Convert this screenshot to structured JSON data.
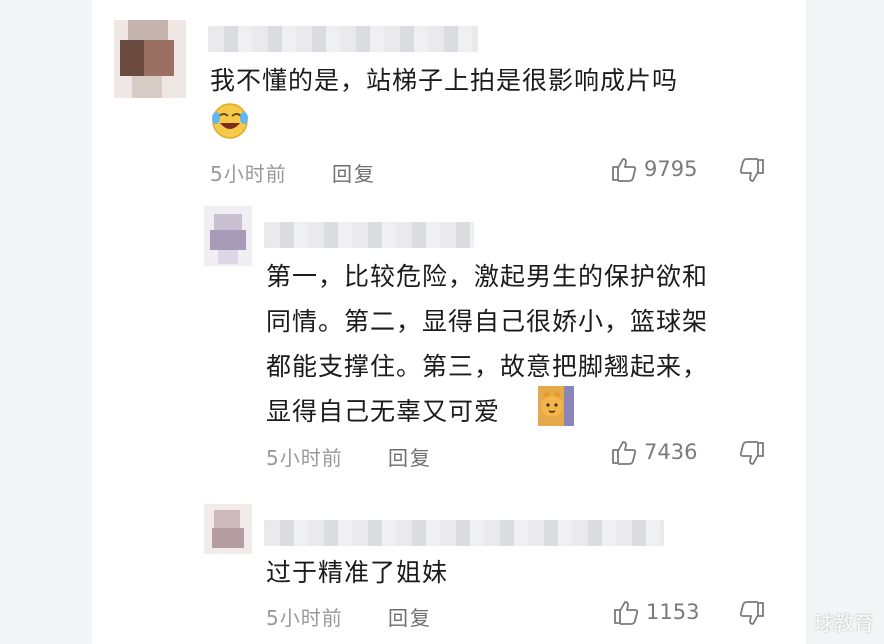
{
  "comments": [
    {
      "text": "我不懂的是，站梯子上拍是很影响成片吗",
      "emoji": "crying-laughing-emoji",
      "time": "5小时前",
      "reply": "回复",
      "likes": "9795"
    },
    {
      "text": "第一，比较危险，激起男生的保护欲和\n同情。第二，显得自己很娇小，篮球架\n都能支撑住。第三，故意把脚翘起来，\n显得自己无辜又可爱",
      "emoji": "cat-emoji",
      "time": "5小时前",
      "reply": "回复",
      "likes": "7436"
    },
    {
      "text": "过于精准了姐妹",
      "time": "5小时前",
      "reply": "回复",
      "likes": "1153"
    }
  ],
  "watermark": "球教育",
  "colors": {
    "text": "#1b1b1b",
    "meta": "#9a9a9a",
    "icon": "#7a7a7a"
  }
}
